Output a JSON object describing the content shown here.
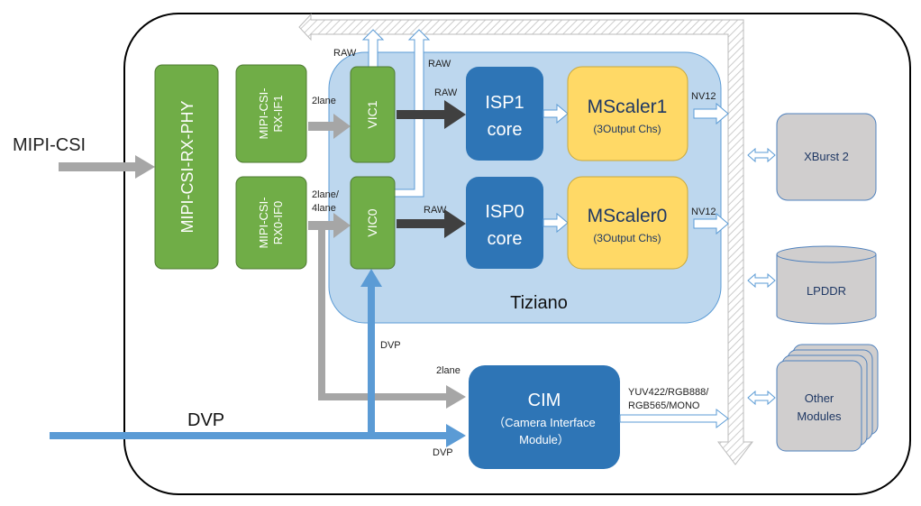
{
  "colors": {
    "green": "#70ad47",
    "blue": "#2e75b6",
    "yellow": "#ffd966",
    "tiziano": "#bdd7ee",
    "gray": "#a6a6a6",
    "dvp": "#5b9bd5",
    "module": "#d0cece"
  },
  "inputs": {
    "mipi": "MIPI-CSI",
    "dvp": "DVP"
  },
  "blocks": {
    "phy": "MIPI-CSI-RX-PHY",
    "if1": [
      "MIPI-CSI-",
      "RX-IF1"
    ],
    "if0": [
      "MIPI-CSI-",
      "RX0-IF0"
    ],
    "vic1": "VIC1",
    "vic0": "VIC0",
    "isp1": [
      "ISP1",
      "core"
    ],
    "isp0": [
      "ISP0",
      "core"
    ],
    "ms1": [
      "MScaler1",
      "(3Output Chs)"
    ],
    "ms0": [
      "MScaler0",
      "(3Output Chs)"
    ],
    "tiziano": "Tiziano",
    "cim": [
      "CIM",
      "（Camera Interface",
      "Module）"
    ],
    "xburst": "XBurst 2",
    "lpddr": "LPDDR",
    "other": [
      "Other",
      "Modules"
    ]
  },
  "labels": {
    "raw": "RAW",
    "lane2": "2lane",
    "lane24": [
      "2lane/",
      "4lane"
    ],
    "nv12": "NV12",
    "dvp": "DVP",
    "cim_out": [
      "YUV422/RGB888/",
      "RGB565/MONO"
    ]
  }
}
